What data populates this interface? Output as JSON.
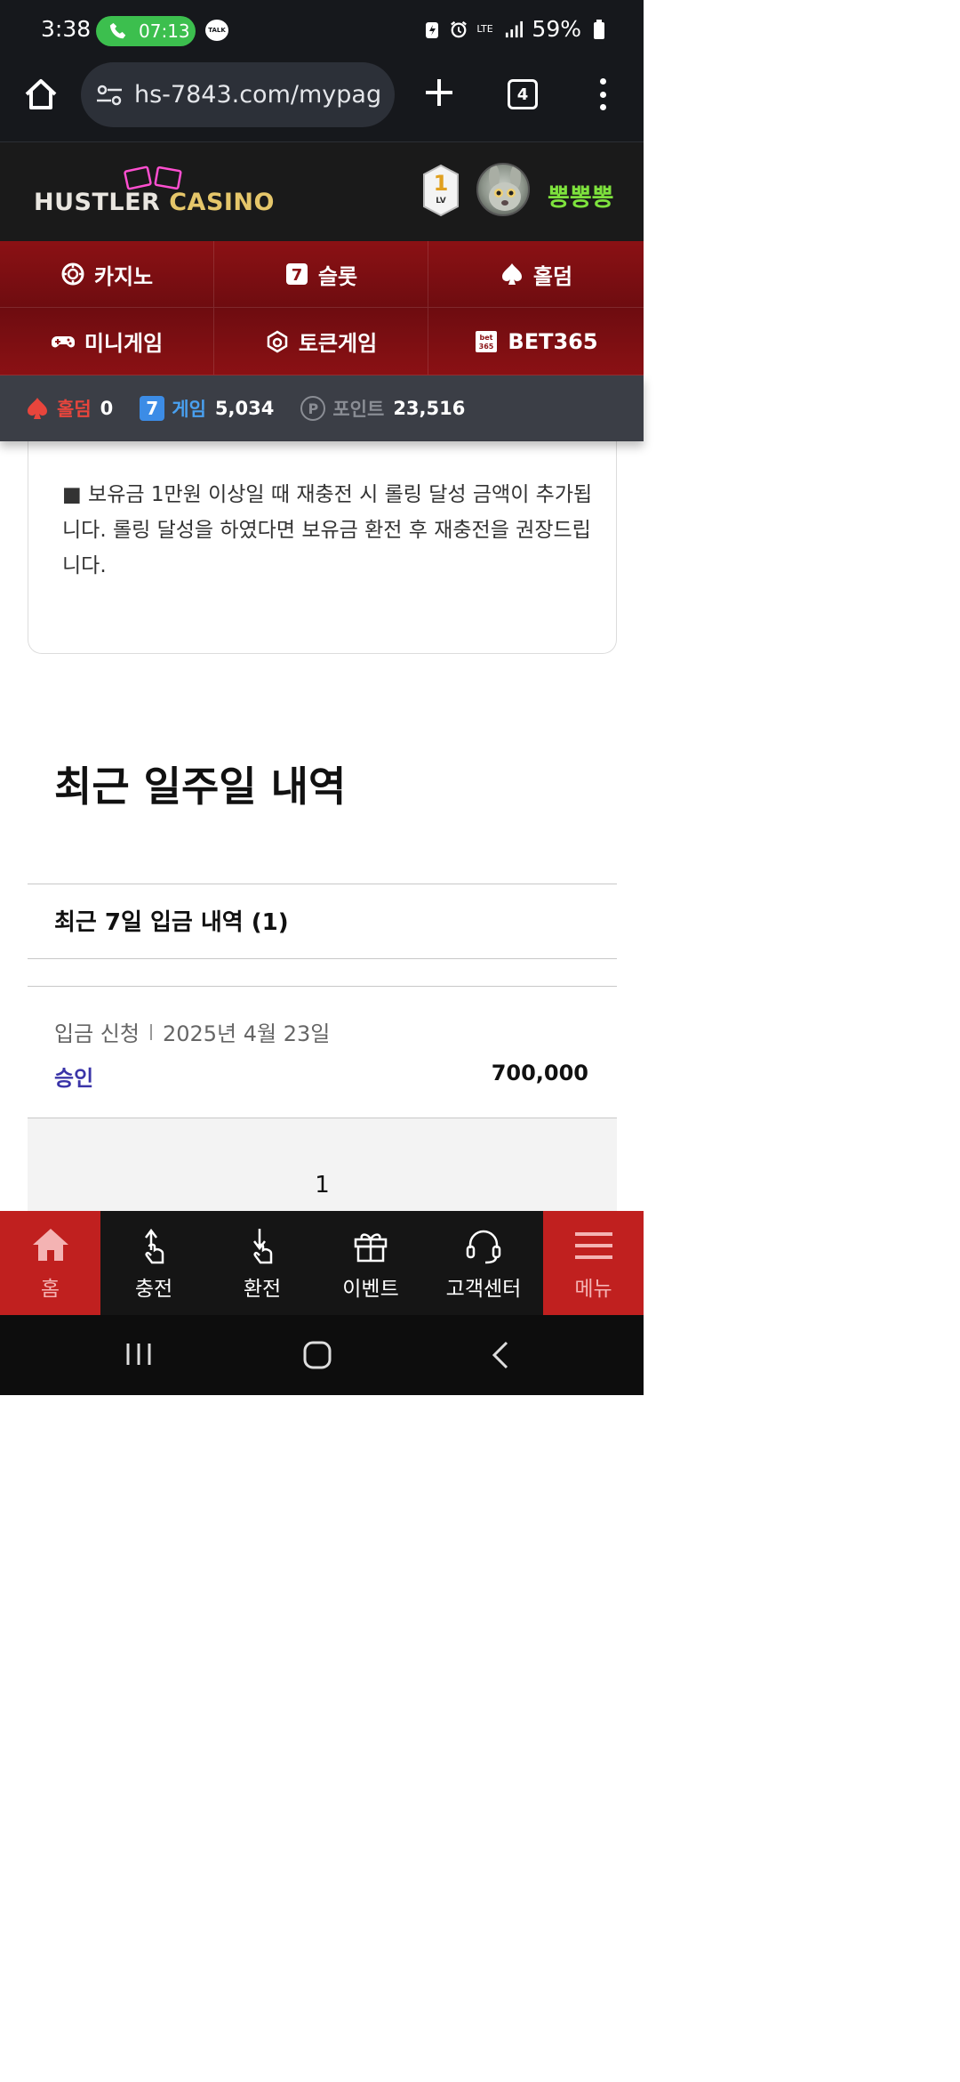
{
  "status_bar": {
    "time": "3:38",
    "call_timer": "07:13",
    "talk_label": "TALK",
    "network": "LTE",
    "battery": "59%"
  },
  "browser": {
    "url": "hs-7843.com/mypag",
    "tab_count": "4"
  },
  "site": {
    "logo_part1": "HUSTLER ",
    "logo_part2": "CASINO",
    "level": "1",
    "level_label": "LV",
    "username": "뽕뽕뽕"
  },
  "nav": [
    {
      "label": "카지노",
      "icon": "casino-chip-icon"
    },
    {
      "label": "슬롯",
      "icon": "slot-seven-icon"
    },
    {
      "label": "홀덤",
      "icon": "spade-icon"
    },
    {
      "label": "미니게임",
      "icon": "gamepad-icon"
    },
    {
      "label": "토큰게임",
      "icon": "token-icon"
    },
    {
      "label": "BET365",
      "icon": "bet365-icon"
    }
  ],
  "balances": {
    "holdem_label": "홀덤",
    "holdem_value": "0",
    "game_label": "게임",
    "game_value": "5,034",
    "point_label": "포인트",
    "point_value": "23,516"
  },
  "notice": {
    "text": "■ 보유금 1만원 이상일 때 재충전 시 롤링 달성 금액이 추가됩니다. 롤링 달성을 하였다면 보유금 환전 후 재충전을 권장드립니다."
  },
  "recent": {
    "title": "최근 일주일 내역",
    "deposit_heading": "최근 7일 입금 내역 (1)",
    "entries": [
      {
        "type": "입금 신청",
        "date": "2025년 4월 23일",
        "status": "승인",
        "amount": "700,000"
      }
    ],
    "page": "1"
  },
  "tabbar": [
    {
      "label": "홈",
      "icon": "home-icon"
    },
    {
      "label": "충전",
      "icon": "deposit-icon"
    },
    {
      "label": "환전",
      "icon": "withdraw-icon"
    },
    {
      "label": "이벤트",
      "icon": "gift-icon"
    },
    {
      "label": "고객센터",
      "icon": "headset-icon"
    },
    {
      "label": "메뉴",
      "icon": "hamburger-icon"
    }
  ],
  "colors": {
    "nav_red": "#8b1114",
    "username_green": "#7ee23d",
    "status_approved": "#3a34a8",
    "tab_active_red": "#c0201f"
  }
}
